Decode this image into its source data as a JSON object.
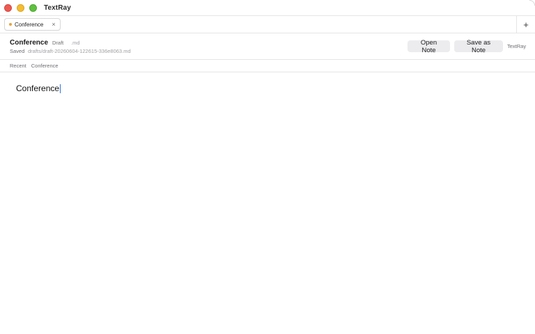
{
  "window": {
    "app_title": "TextRay"
  },
  "tabs": [
    {
      "label": "Conference",
      "close_glyph": "×",
      "active": true,
      "dot_color": "#e8a33a"
    }
  ],
  "tabbar": {
    "add_glyph": "+"
  },
  "doc": {
    "title": "Conference",
    "status": "Draft",
    "extension": ".md",
    "saved_label": "Saved",
    "path": "drafts/draft-20260604-122615-336e8063.md"
  },
  "toolbar": {
    "open_label": "Open Note",
    "save_label": "Save as Note",
    "brand": "TextRay"
  },
  "breadcrumb": {
    "items": [
      "Recent",
      "Conference"
    ]
  },
  "editor": {
    "content": "Conference"
  },
  "colors": {
    "close": "#ee5a52",
    "minimize": "#f5bd2f",
    "maximize": "#5fc13e",
    "caret": "#2f6fde"
  },
  "icons": {
    "tab_close": "close-icon",
    "tab_add": "plus-icon",
    "tab_dot": "modified-dot-icon"
  }
}
